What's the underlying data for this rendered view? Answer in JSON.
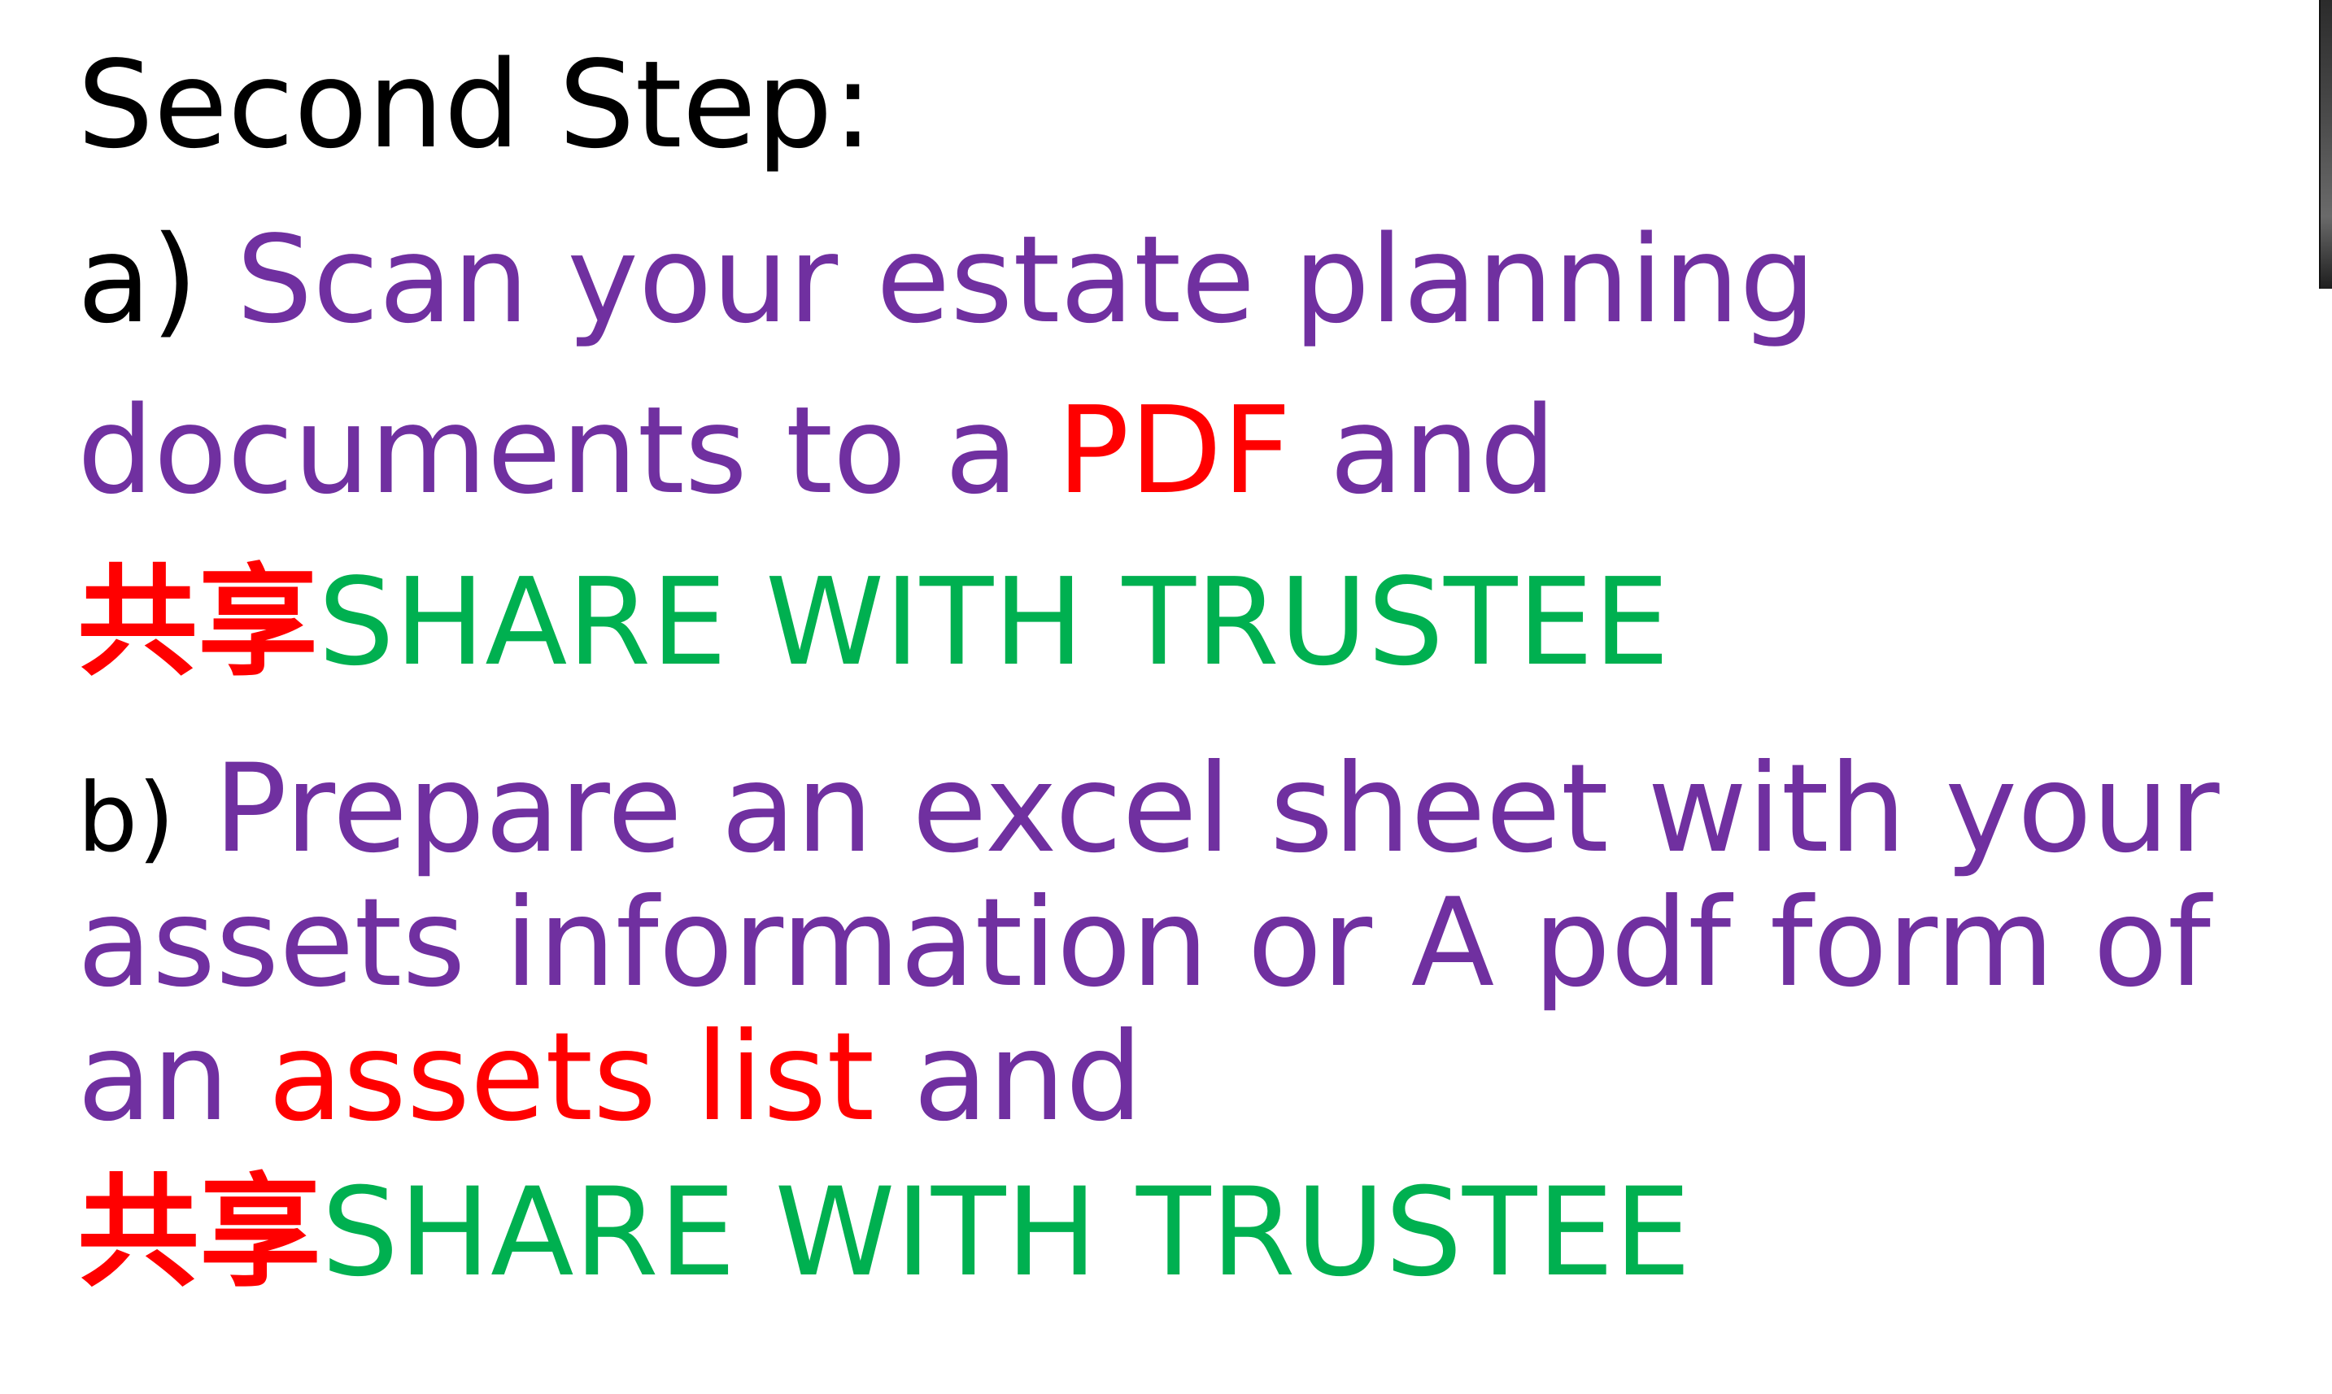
{
  "slide": {
    "title": "Second Step:",
    "item_a": {
      "marker": "a)",
      "line1_text": "Scan your estate planning",
      "line2_text": "documents to a",
      "line2_highlight": "PDF",
      "line2_tail": "and",
      "line3_cjk": "共享",
      "line3_text": "SHARE WITH TRUSTEE"
    },
    "item_b": {
      "marker": "b)",
      "line1_text": "Prepare an excel sheet with your",
      "line2_text": "assets information or A pdf form of",
      "line3_lead": "an",
      "line3_highlight": "assets list",
      "line3_tail": "and",
      "line4_cjk": "共享",
      "line4_text": "SHARE WITH TRUSTEE"
    }
  },
  "colors": {
    "text": "#000000",
    "purple": "#7030a0",
    "red": "#ff0000",
    "green": "#00b050",
    "background": "#ffffff"
  },
  "icons": {
    "thumbnail": "video-thumbnail-sliver"
  }
}
